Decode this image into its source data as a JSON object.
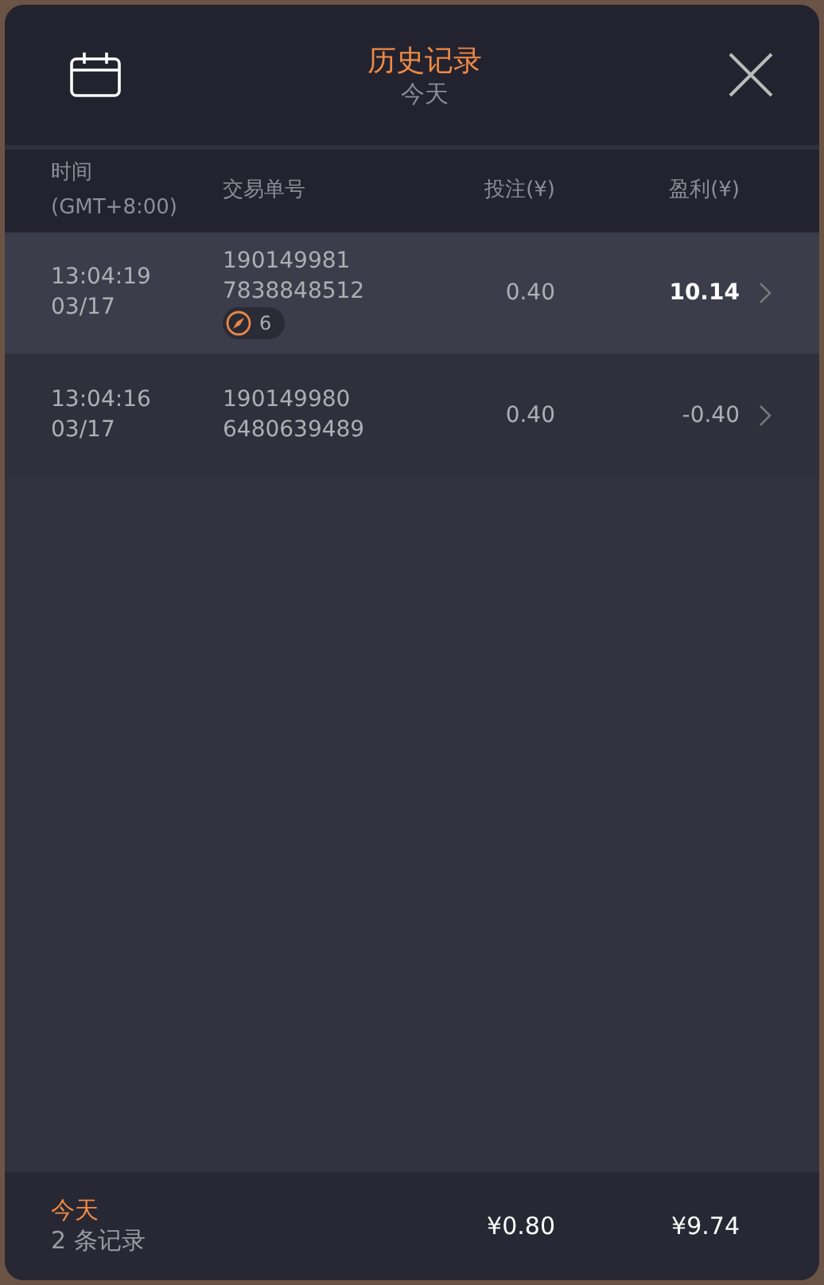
{
  "header": {
    "title": "历史记录",
    "subtitle": "今天"
  },
  "columns": [
    {
      "label": "时间\n(GMT+8:00)"
    },
    {
      "label": "交易单号"
    },
    {
      "label": "投注(¥)"
    },
    {
      "label": "盈利(¥)"
    }
  ],
  "rows": [
    {
      "time": "13:04:19",
      "date": "03/17",
      "order": "190149981\n7838848512",
      "badge": "6",
      "bet": "0.40",
      "profit": "10.14",
      "win": true,
      "selected": true
    },
    {
      "time": "13:04:16",
      "date": "03/17",
      "order": "190149980\n6480639489",
      "bet": "0.40",
      "profit": "-0.40",
      "win": false,
      "selected": false
    }
  ],
  "footer": {
    "period": "今天",
    "count": "2 条记录",
    "total_bet": "¥0.80",
    "total_profit": "¥9.74"
  }
}
